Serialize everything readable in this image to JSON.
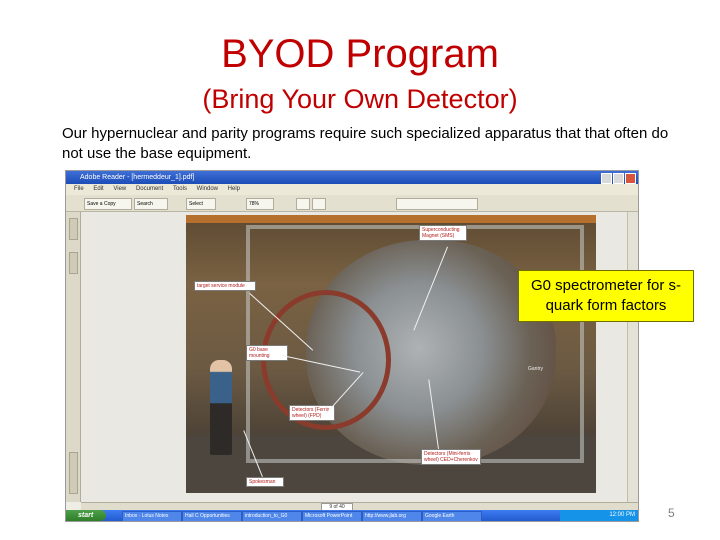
{
  "slide": {
    "title": "BYOD Program",
    "subtitle": "(Bring Your Own Detector)",
    "body": "Our hypernuclear and parity programs require such specialized apparatus that that often do not use the base equipment.",
    "callout": "G0 spectrometer for s-quark form factors",
    "slide_number": "5"
  },
  "colors": {
    "title": "#c00000",
    "callout_bg": "#ffff00",
    "slide_number": "#7f7f7f"
  },
  "screenshot": {
    "window_title": "Adobe Reader - [hermeddeur_1].pdf]",
    "menu": [
      "File",
      "Edit",
      "View",
      "Document",
      "Tools",
      "Window",
      "Help"
    ],
    "toolbar": {
      "save": "Save a Copy",
      "search": "Search",
      "select": "Select",
      "zoom": "78%"
    },
    "sidebar_tabs": [
      "Bookmarks",
      "Pages",
      "Attachments"
    ],
    "photo_labels": {
      "magnet": "Superconducting Magnet (SMS)",
      "target": "target service module",
      "base": "G0 base mounting",
      "detectors": "Detectors (Ferris wheel) (FPD)",
      "cryo": "Detectors (Mini-ferris wheel) CED+Cherenkov",
      "spokesman": "Spokesman",
      "gantry": "Gantry"
    },
    "page_indicator": "9 of 40",
    "taskbar": {
      "start": "start",
      "tasks": [
        "Inbox - Lotus Notes",
        "Hall C Opportunities",
        "introduction_to_G0",
        "Microsoft PowerPoint",
        "http://www.jlab.org",
        "Google Earth"
      ],
      "clock": "12:00 PM"
    }
  }
}
